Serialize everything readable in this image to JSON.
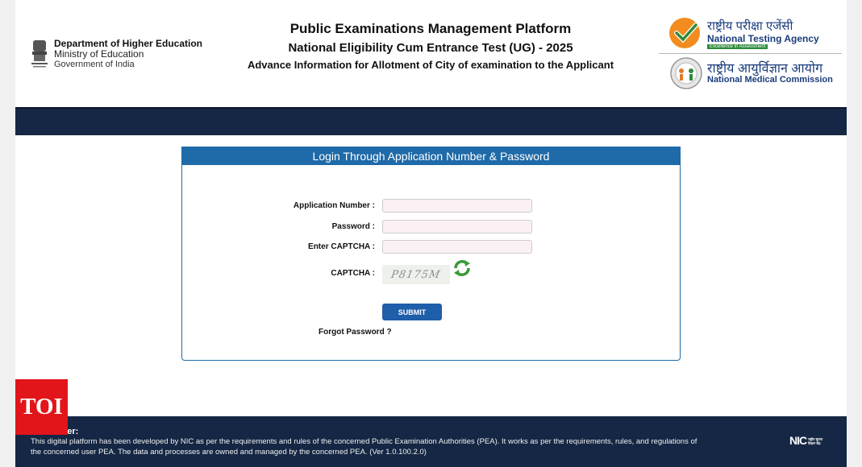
{
  "header": {
    "dept_line1": "Department of Higher Education",
    "dept_line2": "Ministry of Education",
    "dept_line3": "Government of India",
    "title": "Public Examinations Management Platform",
    "subtitle": "National Eligibility Cum Entrance Test (UG) - 2025",
    "subtitle2": "Advance Information for Allotment of City of examination to the Applicant",
    "nta_hindi": "राष्ट्रीय परीक्षा एजेंसी",
    "nta_english": "National Testing Agency",
    "nta_tagline": "Excellence in Assessment",
    "nmc_hindi": "राष्ट्रीय आयुर्विज्ञान आयोग",
    "nmc_english": "National Medical Commission"
  },
  "login": {
    "panel_title": "Login Through Application Number & Password",
    "application_number_label": "Application Number :",
    "password_label": "Password :",
    "captcha_entry_label": "Enter CAPTCHA :",
    "captcha_label": "CAPTCHA :",
    "captcha_text": "P8175M",
    "submit_label": "SUBMIT",
    "forgot_password": "Forgot Password ?"
  },
  "footer": {
    "disclaimer_title": "Disclaimer:",
    "disclaimer_text": "This digital platform has been developed by NIC as per the requirements and rules of the concerned Public Examination Authorities (PEA). It works as per the requirements, rules, and regulations of the concerned user PEA. The data and processes are owned and managed by the concerned PEA. (Ver 1.0.100.2.0)",
    "nic_logo": "NIC",
    "nic_small": "राष्ट्रीय सूचना विज्ञान केंद्र"
  },
  "watermark": {
    "label": "TOI"
  },
  "colors": {
    "navy": "#152744",
    "panel_blue": "#1f6aa8",
    "submit_blue": "#1f5ea8",
    "toi_red": "#e1151a"
  }
}
